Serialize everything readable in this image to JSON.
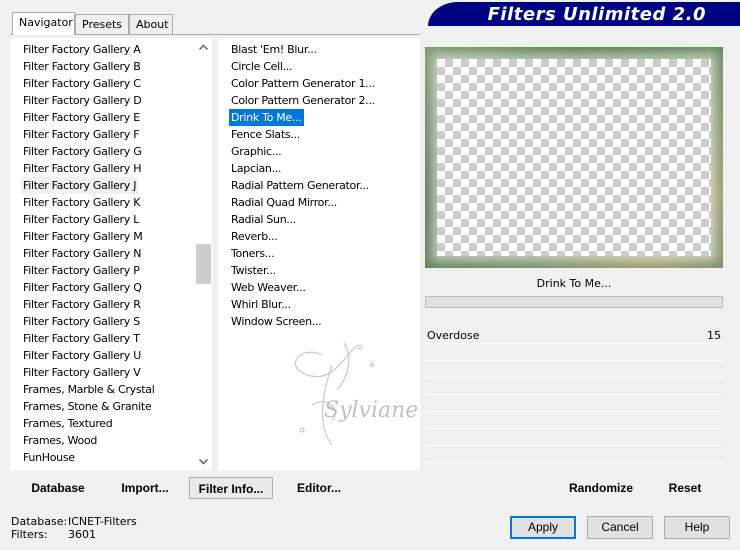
{
  "window": {
    "title": "Filters Unlimited 2.0"
  },
  "tabs": [
    "Navigator",
    "Presets",
    "About"
  ],
  "categories": [
    "Filter Factory Gallery A",
    "Filter Factory Gallery B",
    "Filter Factory Gallery C",
    "Filter Factory Gallery D",
    "Filter Factory Gallery E",
    "Filter Factory Gallery F",
    "Filter Factory Gallery G",
    "Filter Factory Gallery H",
    "Filter Factory Gallery J",
    "Filter Factory Gallery K",
    "Filter Factory Gallery L",
    "Filter Factory Gallery M",
    "Filter Factory Gallery N",
    "Filter Factory Gallery P",
    "Filter Factory Gallery Q",
    "Filter Factory Gallery R",
    "Filter Factory Gallery S",
    "Filter Factory Gallery T",
    "Filter Factory Gallery U",
    "Filter Factory Gallery V",
    "Frames, Marble & Crystal",
    "Frames, Stone & Granite",
    "Frames, Textured",
    "Frames, Wood",
    "FunHouse"
  ],
  "selected_category": "Filter Factory Gallery J",
  "filters": [
    "Blast 'Em! Blur...",
    "Circle Cell...",
    "Color Pattern Generator 1...",
    "Color Pattern Generator 2...",
    "Drink To Me...",
    "Fence Slats...",
    "Graphic...",
    "Lapcian...",
    "Radial Pattern Generator...",
    "Radial Quad Mirror...",
    "Radial Sun...",
    "Reverb...",
    "Toners...",
    "Twister...",
    "Web Weaver...",
    "Whirl Blur...",
    "Window Screen..."
  ],
  "selected_filter": "Drink To Me...",
  "preview_filter_name": "Drink To Me...",
  "parameters": [
    {
      "label": "Overdose",
      "value": "15"
    }
  ],
  "left_buttons": [
    "Database",
    "Import...",
    "Filter Info...",
    "Editor..."
  ],
  "right_buttons": [
    "Randomize",
    "Reset"
  ],
  "status": {
    "database_label": "Database:",
    "database_value": "ICNET-Filters",
    "filters_label": "Filters:",
    "filters_value": "3601"
  },
  "dialog_buttons": {
    "apply": "Apply",
    "cancel": "Cancel",
    "help": "Help"
  },
  "watermark_text": "Sylviane",
  "colors": {
    "banner": "#00037f",
    "selection": "#0078d7",
    "preview_frame": "#6e8c62"
  }
}
